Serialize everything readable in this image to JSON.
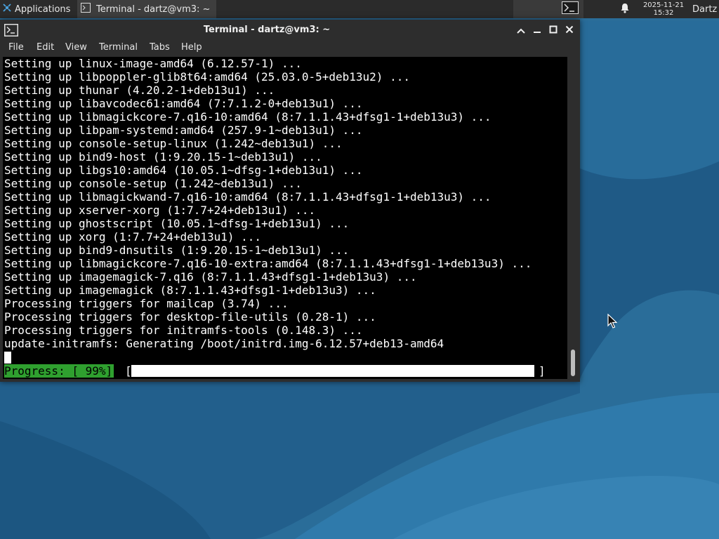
{
  "panel": {
    "applications_label": "Applications",
    "applications_icon": "xfce-logo-icon",
    "task_label": "Terminal - dartz@vm3: ~",
    "task_icon": "terminal-icon",
    "launcher_icon": "terminal-icon",
    "notification_icon": "bell-icon",
    "clock_date": "2025-11-21",
    "clock_time": "15:32",
    "user_label": "Dartz"
  },
  "window": {
    "title": "Terminal - dartz@vm3: ~",
    "menu": [
      "File",
      "Edit",
      "View",
      "Terminal",
      "Tabs",
      "Help"
    ],
    "controls": [
      "chevron-up-icon",
      "minimize-icon",
      "maximize-icon",
      "close-icon"
    ]
  },
  "terminal": {
    "lines": [
      "Setting up linux-image-amd64 (6.12.57-1) ...",
      "Setting up libpoppler-glib8t64:amd64 (25.03.0-5+deb13u2) ...",
      "Setting up thunar (4.20.2-1+deb13u1) ...",
      "Setting up libavcodec61:amd64 (7:7.1.2-0+deb13u1) ...",
      "Setting up libmagickcore-7.q16-10:amd64 (8:7.1.1.43+dfsg1-1+deb13u3) ...",
      "Setting up libpam-systemd:amd64 (257.9-1~deb13u1) ...",
      "Setting up console-setup-linux (1.242~deb13u1) ...",
      "Setting up bind9-host (1:9.20.15-1~deb13u1) ...",
      "Setting up libgs10:amd64 (10.05.1~dfsg-1+deb13u1) ...",
      "Setting up console-setup (1.242~deb13u1) ...",
      "Setting up libmagickwand-7.q16-10:amd64 (8:7.1.1.43+dfsg1-1+deb13u3) ...",
      "Setting up xserver-xorg (1:7.7+24+deb13u1) ...",
      "Setting up ghostscript (10.05.1~dfsg-1+deb13u1) ...",
      "Setting up xorg (1:7.7+24+deb13u1) ...",
      "Setting up bind9-dnsutils (1:9.20.15-1~deb13u1) ...",
      "Setting up libmagickcore-7.q16-10-extra:amd64 (8:7.1.1.43+dfsg1-1+deb13u3) ...",
      "Setting up imagemagick-7.q16 (8:7.1.1.43+dfsg1-1+deb13u3) ...",
      "Setting up imagemagick (8:7.1.1.43+dfsg1-1+deb13u3) ...",
      "Processing triggers for mailcap (3.74) ...",
      "Processing triggers for desktop-file-utils (0.28-1) ...",
      "Processing triggers for initramfs-tools (0.148.3) ...",
      "update-initramfs: Generating /boot/initrd.img-6.12.57+deb13-amd64"
    ],
    "progress_label": "Progress: [ 99%]",
    "progress_open": "[",
    "progress_close": "]",
    "progress_percent": 99,
    "progress_color": "#2fa02f"
  },
  "colors": {
    "panel_bg": "#2b2b2b",
    "window_bg": "#2d2d2d",
    "terminal_bg": "#000000",
    "terminal_fg": "#ffffff",
    "wallpaper": "#2a6f9b"
  }
}
